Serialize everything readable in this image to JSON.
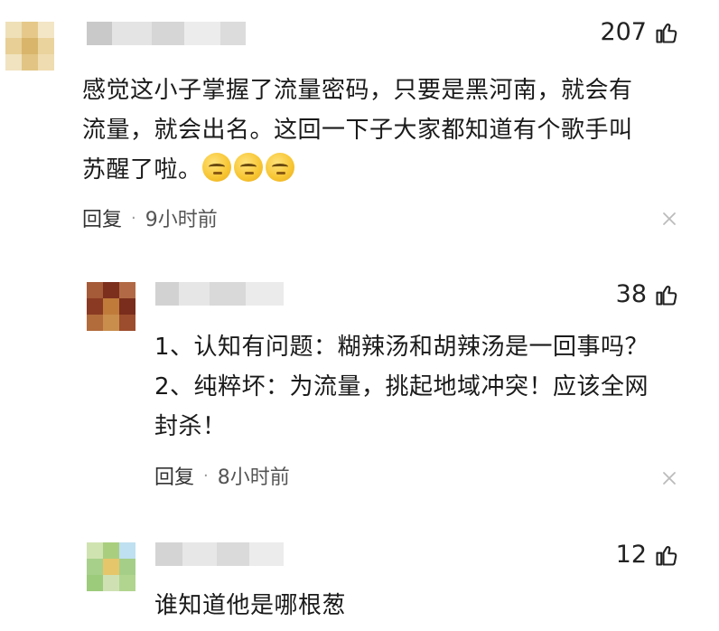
{
  "comments": [
    {
      "likes": "207",
      "text_lines": [
        "感觉这小子掌握了流量密码，只要是黑河南，就会有",
        "流量，就会出名。这回一下子大家都知道有个歌手叫",
        "苏醒了啦。"
      ],
      "reply_label": "回复",
      "separator": "·",
      "time": "9小时前"
    },
    {
      "likes": "38",
      "text_lines": [
        "1、认知有问题：糊辣汤和胡辣汤是一回事吗？",
        "2、纯粹坏：为流量，挑起地域冲突！应该全网",
        "封杀！"
      ],
      "reply_label": "回复",
      "separator": "·",
      "time": "8小时前"
    },
    {
      "likes": "12",
      "text_lines": [
        "谁知道他是哪根葱"
      ]
    }
  ],
  "icons": {
    "like": "thumbs-up-icon",
    "close": "close-icon",
    "emoji": "smirk-emoji-icon"
  },
  "colors": {
    "text": "#1a1a1a",
    "meta": "#555555",
    "close": "#bbbbbb"
  }
}
